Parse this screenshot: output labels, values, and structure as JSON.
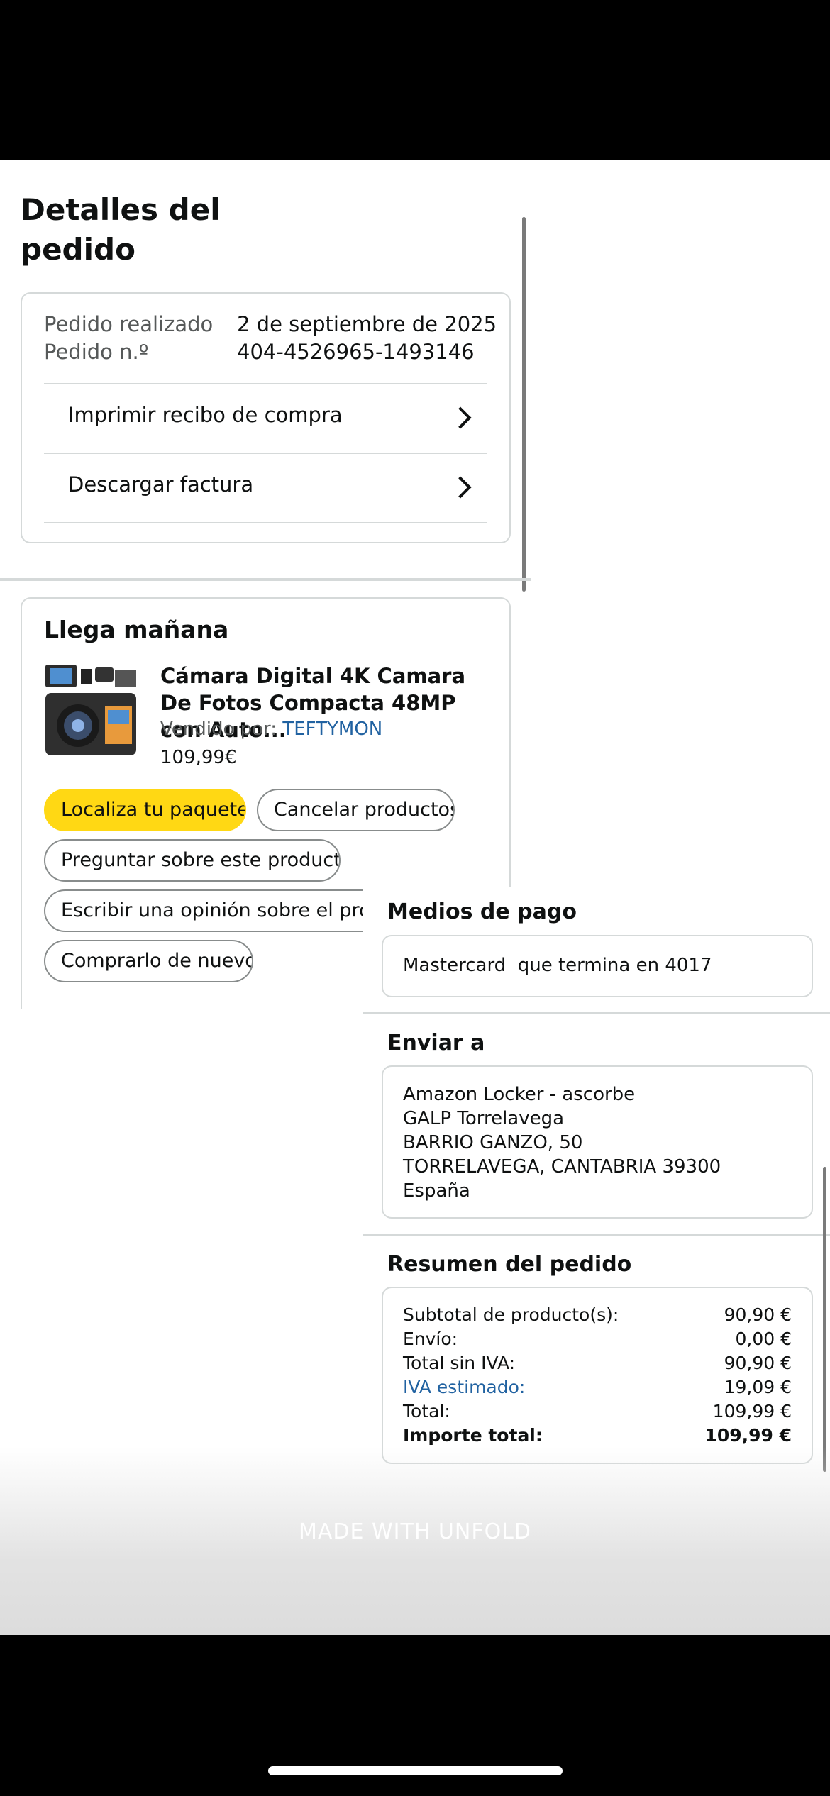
{
  "page": {
    "title": "Detalles del pedido"
  },
  "order_info": {
    "placed_label": "Pedido realizado",
    "placed_value": "2 de septiembre de 2025",
    "number_label": "Pedido n.º",
    "number_value": "404-4526965-1493146",
    "links": [
      "Imprimir recibo de compra",
      "Descargar factura"
    ]
  },
  "delivery": {
    "title": "Llega mañana",
    "product_title": "Cámara Digital 4K Camara De Fotos Compacta 48MP con Auto...",
    "seller_label": "Vendido por:",
    "seller_name": "TEFTYMON",
    "price": "109,99€",
    "actions": {
      "track": "Localiza tu paquete",
      "cancel": "Cancelar productos",
      "ask": "Preguntar sobre este producto",
      "review": "Escribir una opinión sobre el producto",
      "buy_again": "Comprarlo de nuevo"
    }
  },
  "payment": {
    "title": "Medios de pago",
    "method": "Mastercard  que termina en 4017"
  },
  "shipping": {
    "title": "Enviar a",
    "lines": [
      "Amazon Locker - ascorbe",
      "GALP Torrelavega",
      "BARRIO GANZO, 50",
      "TORRELAVEGA, CANTABRIA 39300",
      "España"
    ]
  },
  "summary": {
    "title": "Resumen del pedido",
    "rows": [
      {
        "label": "Subtotal de producto(s):",
        "value": "90,90 €"
      },
      {
        "label": "Envío:",
        "value": "0,00 €"
      },
      {
        "label": "Total sin IVA:",
        "value": "90,90 €"
      },
      {
        "label": "IVA estimado:",
        "value": "19,09 €"
      },
      {
        "label": "Total:",
        "value": "109,99 €"
      },
      {
        "label": "Importe total:",
        "value": "109,99 €"
      }
    ]
  },
  "watermark": "MADE WITH UNFOLD",
  "colors": {
    "accent_yellow": "#ffd814",
    "link_blue": "#2162a1",
    "border": "#d5d9d9"
  }
}
